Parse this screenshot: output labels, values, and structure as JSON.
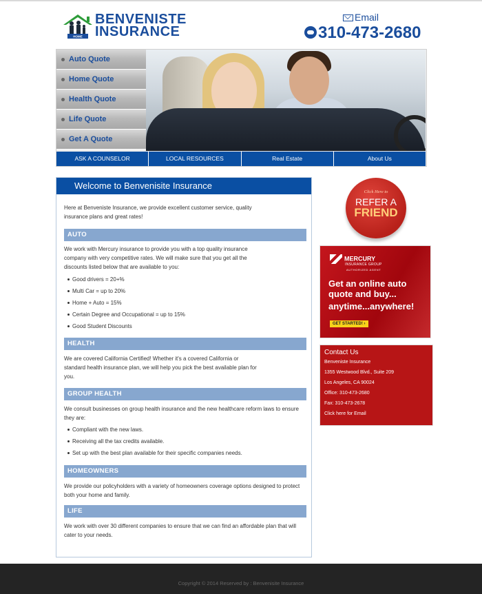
{
  "header": {
    "logo_line1": "BENVENISTE",
    "logo_line2": "INSURANCE",
    "logo_house_label": "HOME",
    "email_label": "Email",
    "phone": "310-473-2680"
  },
  "side_menu": {
    "items": [
      {
        "label": "Auto Quote"
      },
      {
        "label": "Home Quote"
      },
      {
        "label": "Health Quote"
      },
      {
        "label": "Life Quote"
      },
      {
        "label": "Get A Quote"
      }
    ]
  },
  "nav": {
    "items": [
      {
        "label": "ASK A COUNSELOR"
      },
      {
        "label": "LOCAL RESOURCES"
      },
      {
        "label": "Real Estate"
      },
      {
        "label": "About Us"
      }
    ]
  },
  "main": {
    "welcome": "Welcome to Benvenisite Insurance",
    "intro": "Here at Benveniste Insurance, we provide excellent customer service, quality insurance plans and great rates!",
    "auto": {
      "title": "AUTO",
      "text": "We work with Mercury insurance to provide you with a top quality insurance company with very competitive rates. We will make sure that you get all the discounts listed below that are available to you:",
      "bullets": [
        "Good drivers = 20+%",
        "Multi Car = up to 20%",
        "Home + Auto = 15%",
        "Certain Degree and Occupational = up to 15%",
        "Good Student Discounts"
      ]
    },
    "health": {
      "title": "HEALTH",
      "text": "We are covered California Certified! Whether it's a covered California or standard health insurance plan, we will help you pick the best available plan for you."
    },
    "group": {
      "title": "GROUP HEALTH",
      "text": "We consult businesses on group health insurance and the new healthcare reform laws to ensure they are:",
      "bullets": [
        "Compliant with the new laws.",
        "Receiving all the tax credits available.",
        "Set up with the best plan available for their specific companies needs."
      ]
    },
    "home": {
      "title": "HOMEOWNERS",
      "text": "We provide our policyholders with a variety of homeowners coverage options designed to protect both your home and family."
    },
    "life": {
      "title": "LIFE",
      "text": "We work with over 30 different companies to ensure that we can find an affordable plan that will cater to your needs."
    }
  },
  "refer": {
    "line1": "Click Here to",
    "line2": "REFER A",
    "line3": "FRIEND"
  },
  "mercury_ad": {
    "brand": "MERCURY",
    "sub": "INSURANCE GROUP",
    "agent": "AUTHORIZED AGENT",
    "headline": "Get an online auto quote and buy...",
    "headline2": "anytime...anywhere!",
    "cta": "GET STARTED! ›"
  },
  "contact": {
    "title": "Contact Us",
    "lines": [
      "Benveniste Insurance",
      "1355 Westwood Blvd., Suite 209",
      "Los Angeles, CA 90024",
      "Office: 310-473-2680",
      "Fax: 310-473-2678",
      "Click here for Email"
    ]
  },
  "footer": {
    "text": "Copyright © 2014 Reserved by : Benvenisite Insurance"
  },
  "colors": {
    "brand_blue": "#1a4d9c",
    "nav_blue": "#0a4fa3",
    "section_blue": "#87a7cf",
    "contact_red": "#b71516",
    "footer": "#242424"
  }
}
